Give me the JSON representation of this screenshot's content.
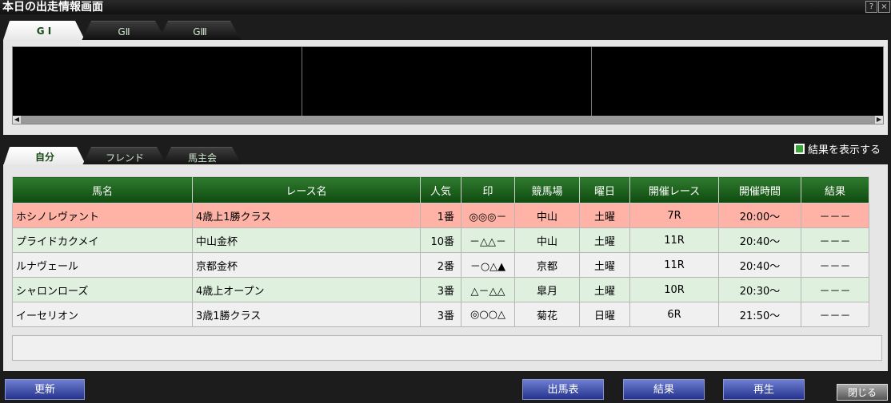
{
  "window": {
    "title": "本日の出走情報画面",
    "help_label": "?",
    "close_label": "×"
  },
  "grade_tabs": [
    "G I",
    "GⅡ",
    "GⅢ"
  ],
  "filter_tabs": [
    "自分",
    "フレンド",
    "馬主会"
  ],
  "show_results": {
    "label": "結果を表示する",
    "checked": true
  },
  "table": {
    "headers": [
      "馬名",
      "レース名",
      "人気",
      "印",
      "競馬場",
      "曜日",
      "開催レース",
      "開催時間",
      "結果"
    ],
    "rows": [
      {
        "cells": [
          "ホシノレヴァント",
          "4歳上1勝クラス",
          "1番",
          "◎◎◎－",
          "中山",
          "土曜",
          "7R",
          "20:00～",
          "－－－"
        ],
        "bg": "#ffb3a6"
      },
      {
        "cells": [
          "プライドカクメイ",
          "中山金杯",
          "10番",
          "－△△－",
          "中山",
          "土曜",
          "11R",
          "20:40～",
          "－－－"
        ],
        "bg": "#dff0df"
      },
      {
        "cells": [
          "ルナヴェール",
          "京都金杯",
          "2番",
          "－○△▲",
          "京都",
          "土曜",
          "11R",
          "20:40～",
          "－－－"
        ],
        "bg": "#f0f0f0"
      },
      {
        "cells": [
          "シャロンローズ",
          "4歳上オープン",
          "3番",
          "△－△△",
          "皐月",
          "土曜",
          "10R",
          "20:30～",
          "－－－"
        ],
        "bg": "#dff0df"
      },
      {
        "cells": [
          "イーセリオン",
          "3歳1勝クラス",
          "3番",
          "◎○○△",
          "菊花",
          "日曜",
          "6R",
          "21:50～",
          "－－－"
        ],
        "bg": "#f0f0f0"
      }
    ]
  },
  "buttons": {
    "refresh": "更新",
    "race_card": "出馬表",
    "results": "結果",
    "replay": "再生",
    "close": "閉じる"
  },
  "colors": {
    "accent_green": "#1f6a1f",
    "button_blue": "#3a46a6",
    "highlight_row": "#ffb3a6"
  }
}
